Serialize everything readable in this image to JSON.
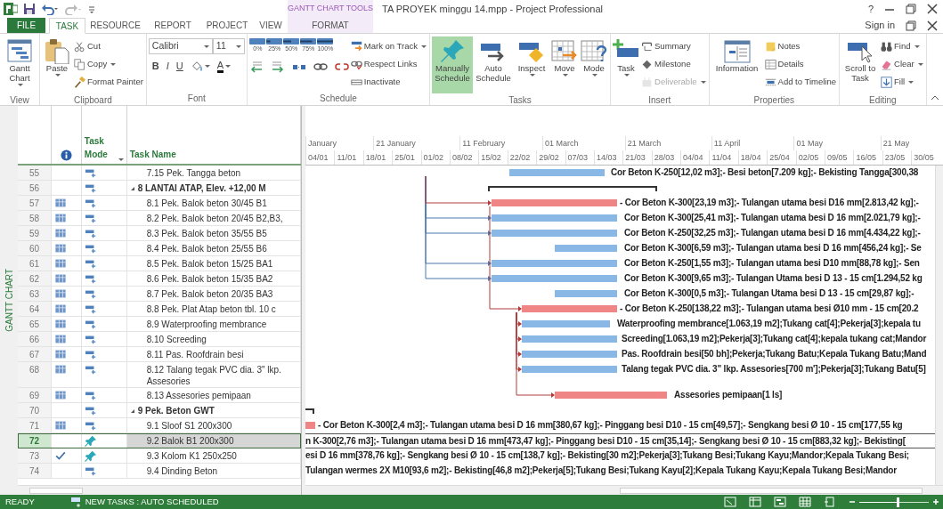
{
  "window": {
    "title": "TA PROYEK minggu 14.mpp - Project Professional",
    "context_label": "GANTT CHART TOOLS",
    "help": "?",
    "sign_in": "Sign in"
  },
  "tabs": [
    {
      "label": "FILE",
      "kind": "file",
      "selected": false
    },
    {
      "label": "TASK",
      "kind": "tab",
      "selected": true
    },
    {
      "label": "RESOURCE",
      "kind": "tab",
      "selected": false
    },
    {
      "label": "REPORT",
      "kind": "tab",
      "selected": false
    },
    {
      "label": "PROJECT",
      "kind": "tab",
      "selected": false
    },
    {
      "label": "VIEW",
      "kind": "tab",
      "selected": false
    },
    {
      "label": "FORMAT",
      "kind": "contextual",
      "selected": false
    }
  ],
  "ribbon": {
    "groups": [
      {
        "label": "View",
        "items": [
          {
            "kind": "large",
            "label": "Gantt Chart",
            "dropdown": true
          }
        ]
      },
      {
        "label": "Clipboard",
        "items": [
          {
            "kind": "large",
            "label": "Paste",
            "dropdown": true
          },
          {
            "kind": "small",
            "label": "Cut"
          },
          {
            "kind": "small",
            "label": "Copy",
            "dropdown": true
          },
          {
            "kind": "small",
            "label": "Format Painter"
          }
        ]
      },
      {
        "label": "Font",
        "items": [
          {
            "kind": "font",
            "font_name": "Calibri",
            "font_size": "11",
            "styles": [
              "B",
              "I",
              "U"
            ],
            "color_glyph": "A"
          }
        ]
      },
      {
        "label": "Schedule",
        "items": [
          {
            "kind": "percent",
            "labels": [
              "0%",
              "25%",
              "50%",
              "75%",
              "100%"
            ]
          },
          {
            "kind": "small",
            "label": "Mark on Track",
            "dropdown": true
          },
          {
            "kind": "small",
            "label": "Respect Links"
          },
          {
            "kind": "small",
            "label": "Inactivate"
          }
        ]
      },
      {
        "label": "Tasks",
        "items": [
          {
            "kind": "large",
            "label": "Manually Schedule",
            "selected": true
          },
          {
            "kind": "large",
            "label": "Auto Schedule",
            "selected": false
          },
          {
            "kind": "large",
            "label": "Inspect",
            "dropdown": true
          },
          {
            "kind": "large",
            "label": "Move",
            "dropdown": true
          },
          {
            "kind": "large",
            "label": "Mode",
            "dropdown": true
          }
        ]
      },
      {
        "label": "Insert",
        "items": [
          {
            "kind": "large",
            "label": "Task",
            "dropdown": true
          },
          {
            "kind": "small",
            "label": "Summary"
          },
          {
            "kind": "small",
            "label": "Milestone"
          },
          {
            "kind": "small",
            "label": "Deliverable",
            "dropdown": true,
            "disabled": true
          }
        ]
      },
      {
        "label": "Properties",
        "items": [
          {
            "kind": "large",
            "label": "Information"
          },
          {
            "kind": "small",
            "label": "Notes"
          },
          {
            "kind": "small",
            "label": "Details"
          },
          {
            "kind": "small",
            "label": "Add to Timeline"
          }
        ]
      },
      {
        "label": "Editing",
        "items": [
          {
            "kind": "large",
            "label": "Scroll to Task"
          },
          {
            "kind": "small",
            "label": "Find",
            "dropdown": true
          },
          {
            "kind": "small",
            "label": "Clear",
            "dropdown": true
          },
          {
            "kind": "small",
            "label": "Fill",
            "dropdown": true
          }
        ]
      }
    ]
  },
  "view_label": "GANTT CHART",
  "columns": {
    "mode": "Task Mode",
    "name": "Task Name"
  },
  "timescale": {
    "top": [
      "January",
      "21 January",
      "11 February",
      "01 March",
      "21 March",
      "11 April",
      "01 May",
      "21 May"
    ],
    "bottom": [
      "04/01",
      "11/01",
      "18/01",
      "25/01",
      "01/02",
      "08/02",
      "15/02",
      "22/02",
      "29/02",
      "07/03",
      "14/03",
      "21/03",
      "28/03",
      "04/04",
      "11/04",
      "18/04",
      "25/04",
      "02/05",
      "09/05",
      "16/05",
      "23/05",
      "30/05"
    ]
  },
  "tasks": [
    {
      "id": "55",
      "constraint": false,
      "complete": false,
      "manually_scheduled": false,
      "name": "7.15 Pek. Tangga beton",
      "critical": false,
      "selected": false,
      "gantt_label": "Cor Beton K-250[12,02 m3];- Besi beton[7.209 kg];- Bekisting Tangga[300,38"
    },
    {
      "id": "56",
      "summary": true,
      "expanded": true,
      "manually_scheduled": false,
      "name": "8 LANTAI ATAP, Elev. +12,00 M",
      "selected": false,
      "children": [
        {
          "id": "57",
          "constraint": true,
          "complete": false,
          "manually_scheduled": false,
          "name": "8.1 Pek. Balok beton 30/45 B1",
          "critical": true,
          "selected": false,
          "gantt_label": "- Cor Beton K-300[23,19 m3];- Tulangan utama besi D16 mm[2.813,42 kg];-"
        },
        {
          "id": "58",
          "constraint": true,
          "complete": false,
          "manually_scheduled": false,
          "name": "8.2 Pek. Balok beton 20/45 B2,B3,",
          "critical": false,
          "selected": false,
          "gantt_label": "Cor Beton K-300[25,41 m3];- Tulangan utama besi D 16 mm[2.021,79 kg];-"
        },
        {
          "id": "59",
          "constraint": true,
          "complete": false,
          "manually_scheduled": false,
          "name": "8.3 Pek. Balok beton 35/55 B5",
          "critical": false,
          "selected": false,
          "gantt_label": "Cor Beton K-250[32,25 m3];- Tulangan utama besi D 16 mm[4.434,22 kg];-"
        },
        {
          "id": "60",
          "constraint": true,
          "complete": false,
          "manually_scheduled": false,
          "name": "8.4 Pek. Balok beton 25/55 B6",
          "critical": false,
          "selected": false,
          "gantt_label": "Cor Beton K-300[6,59 m3];- Tulangan utama besi D 16 mm[456,24 kg];- Se"
        },
        {
          "id": "61",
          "constraint": true,
          "complete": false,
          "manually_scheduled": false,
          "name": "8.5 Pek. Balok beton 15/25 BA1",
          "critical": false,
          "selected": false,
          "gantt_label": "Cor Beton K-250[1,55 m3];- Tulangan utama besi D10 mm[88,78 kg];- Sen"
        },
        {
          "id": "62",
          "constraint": true,
          "complete": false,
          "manually_scheduled": false,
          "name": "8.6 Pek. Balok beton 15/35 BA2",
          "critical": false,
          "selected": false,
          "gantt_label": "Cor Beton K-300[9,65 m3];- Tulangan Utama besi D 13 - 15 cm[1.294,52 kg"
        },
        {
          "id": "63",
          "constraint": true,
          "complete": false,
          "manually_scheduled": false,
          "name": "8.7 Pek. Balok beton 20/35 BA3",
          "critical": false,
          "selected": false,
          "gantt_label": "Cor Beton K-300[0,5 m3];- Tulangan Utama besi D 13 - 15 cm[29,87 kg];-"
        },
        {
          "id": "64",
          "constraint": true,
          "complete": false,
          "manually_scheduled": false,
          "name": "8.8 Pek. Plat Atap beton tbl. 10 c",
          "critical": true,
          "selected": false,
          "gantt_label": "- Cor Beton K-250[138,22 m3];- Tulangan utama besi Ø10 mm - 15 cm[20.2"
        },
        {
          "id": "65",
          "constraint": true,
          "complete": false,
          "manually_scheduled": false,
          "name": "8.9 Waterproofing membrance",
          "critical": false,
          "selected": false,
          "gantt_label": "Waterproofing membrance[1.063,19 m2];Tukang cat[4];Pekerja[3];kepala tu"
        },
        {
          "id": "66",
          "constraint": true,
          "complete": false,
          "manually_scheduled": false,
          "name": "8.10 Screeding",
          "critical": false,
          "selected": false,
          "gantt_label": "Screeding[1.063,19 m2];Pekerja[3];Tukang cat[4];kepala tukang cat;Mandor"
        },
        {
          "id": "67",
          "constraint": true,
          "complete": false,
          "manually_scheduled": false,
          "name": "8.11 Pas. Roofdrain besi",
          "critical": false,
          "selected": false,
          "gantt_label": "Pas. Roofdrain besi[50 bh];Pekerja;Tukang Batu;Kepala Tukang Batu;Mand"
        },
        {
          "id": "68",
          "constraint": true,
          "complete": false,
          "manually_scheduled": false,
          "name": "8.12 Talang tegak PVC dia. 3\" lkp. Assesories",
          "critical": false,
          "selected": false,
          "gantt_label": "Talang tegak PVC dia. 3\" lkp. Assesories[700 m'];Pekerja[3];Tukang Batu[5]"
        },
        {
          "id": "69",
          "constraint": true,
          "complete": false,
          "manually_scheduled": false,
          "name": "8.13 Assesories pemipaan",
          "critical": true,
          "selected": false,
          "gantt_label": "Assesories pemipaan[1 ls]"
        }
      ]
    },
    {
      "id": "70",
      "summary": true,
      "expanded": true,
      "manually_scheduled": false,
      "name": "9 Pek. Beton GWT",
      "selected": false,
      "children": [
        {
          "id": "71",
          "constraint": true,
          "complete": false,
          "manually_scheduled": false,
          "name": "9.1 Sloof S1 200x300",
          "critical": true,
          "selected": false,
          "gantt_label": "- Cor Beton K-300[2,4 m3];- Tulangan utama besi D 16 mm[380,67 kg];- Pinggang besi D10 - 15 cm[49,57];- Sengkang besi Ø 10 - 15 cm[177,55 kg"
        },
        {
          "id": "72",
          "constraint": false,
          "complete": false,
          "manually_scheduled": true,
          "name": "9.2 Balok B1 200x300",
          "selected": true,
          "gantt_label": "n K-300[2,76 m3];- Tulangan utama besi D 16 mm[473,47 kg];- Pinggang besi D10 - 15 cm[35,14];- Sengkang besi Ø 10 - 15 cm[883,32 kg];- Bekisting["
        },
        {
          "id": "73",
          "constraint": false,
          "complete": true,
          "manually_scheduled": true,
          "name": "9.3 Kolom K1 250x250",
          "selected": false,
          "gantt_label": "esi D 16 mm[378,76 kg];- Sengkang besi Ø 10 - 15 cm[138,7 kg];- Bekisting[30 m2];Pekerja[3];Tukang Besi;Tukang Kayu;Mandor;Kepala Tukang Besi;"
        },
        {
          "id": "74",
          "constraint": false,
          "complete": false,
          "manually_scheduled": false,
          "name": "9.4 Dinding Beton",
          "selected": false,
          "gantt_label": "Tulangan wermes 2X M10[93,6 m2];- Bekisting[46,8 m2];Pekerja[5];Tukang Besi;Tukang Kayu[2];Kepala Tukang Kayu;Kepala Tukang Besi;Mandor"
        }
      ]
    }
  ],
  "status_bar": {
    "ready": "READY",
    "new_tasks": "NEW TASKS : AUTO SCHEDULED",
    "zoom": {
      "level": 0.55
    }
  }
}
